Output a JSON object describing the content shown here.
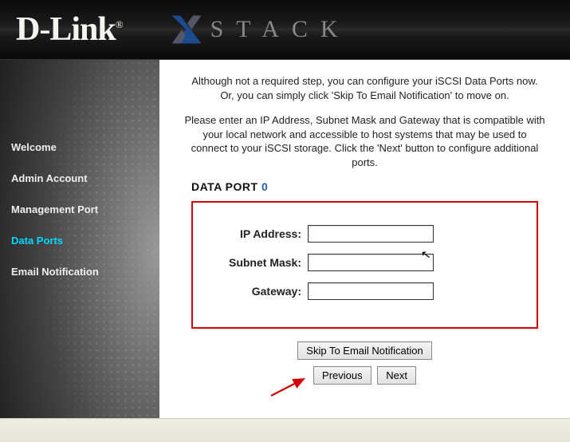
{
  "brand": {
    "logo_text": "D-Link",
    "reg_mark": "®",
    "stack_text": "STACK"
  },
  "sidebar": {
    "items": [
      {
        "label": "Welcome",
        "active": false
      },
      {
        "label": "Admin Account",
        "active": false
      },
      {
        "label": "Management Port",
        "active": false
      },
      {
        "label": "Data Ports",
        "active": true
      },
      {
        "label": "Email Notification",
        "active": false
      }
    ]
  },
  "intro": {
    "p1": "Although not a required step, you can configure your iSCSI Data Ports now. Or, you can simply click 'Skip To Email Notification' to move on.",
    "p2": "Please enter an IP Address, Subnet Mask and Gateway that is compatible with your local network and accessible to host systems that may be used to connect to your iSCSI storage. Click the 'Next' button to configure additional ports."
  },
  "form": {
    "title_prefix": "DATA PORT ",
    "port_number": "0",
    "fields": {
      "ip_label": "IP Address:",
      "ip_value": "",
      "subnet_label": "Subnet Mask:",
      "subnet_value": "",
      "gateway_label": "Gateway:",
      "gateway_value": ""
    }
  },
  "buttons": {
    "skip": "Skip To Email Notification",
    "previous": "Previous",
    "next": "Next"
  },
  "colors": {
    "accent": "#00d8ff",
    "highlight_box": "#d60000",
    "port_num": "#2a5caa"
  }
}
